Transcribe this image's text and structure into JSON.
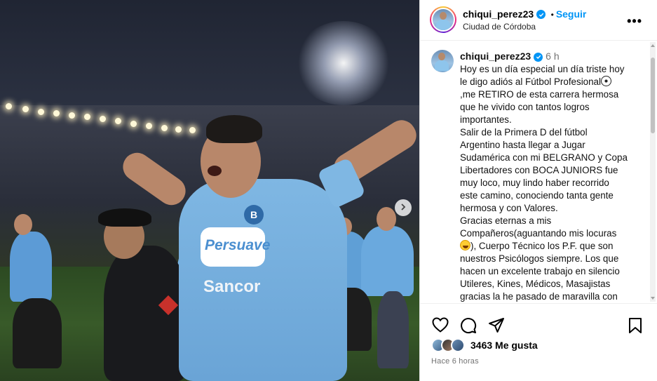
{
  "header": {
    "username": "chiqui_perez23",
    "follow_label": "Seguir",
    "separator": "•",
    "location": "Ciudad de Córdoba",
    "more_label": "•••"
  },
  "photo": {
    "jersey_sponsor": "Persuave",
    "jersey_sponsor2": "Sancor",
    "jersey_crest": "B"
  },
  "caption": {
    "username": "chiqui_perez23",
    "time": "6 h",
    "lines": [
      "Hoy es un día especial un día triste hoy",
      "le digo adiós al Fútbol Profesional",
      ",me RETIRO de esta carrera hermosa",
      "que he vivido con tantos logros",
      "importantes.",
      "Salir de la Primera D del fútbol",
      "Argentino hasta llegar a Jugar",
      "Sudamérica con mi BELGRANO y Copa",
      "Libertadores con BOCA JUNIORS fue",
      "muy loco, muy lindo haber recorrido",
      "este camino, conociendo tanta gente",
      "hermosa y con Valores.",
      "Gracias eternas a mis",
      "Compañeros(aguantando mis locuras",
      "), Cuerpo Técnico los P.F. que son",
      "nuestros Psicólogos siempre. Los que",
      "hacen un excelente trabajo en silencio",
      "Utileres, Kines, Médicos, Masajistas",
      "gracias la he pasado de maravilla con"
    ]
  },
  "likes": {
    "count_text": "3463 Me gusta"
  },
  "time_ago": "Hace 6 horas",
  "colors": {
    "accent": "#0095f6",
    "secondary_text": "#737373"
  },
  "icons": [
    "heart-icon",
    "comment-icon",
    "share-icon",
    "bookmark-icon",
    "more-icon",
    "verified-icon",
    "chevron-right-icon"
  ]
}
